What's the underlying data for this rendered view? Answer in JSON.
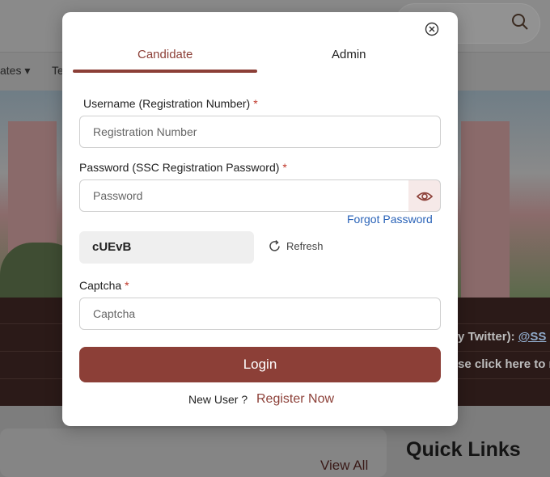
{
  "background": {
    "nav_items": [
      "ates ▾",
      "Te"
    ],
    "band_lines": [
      {
        "text": "rly Twitter):",
        "link": "@SS"
      },
      {
        "text": "se click here to r",
        "link": ""
      }
    ],
    "view_all": "View All",
    "quick_links": "Quick Links"
  },
  "modal": {
    "tabs": {
      "candidate": "Candidate",
      "admin": "Admin"
    },
    "username": {
      "label": "Username (Registration Number)",
      "required": "*",
      "placeholder": "Registration Number"
    },
    "password": {
      "label": "Password (SSC Registration Password)",
      "required": "*",
      "placeholder": "Password"
    },
    "forgot_password": "Forgot Password",
    "captcha_code": "cUEvB",
    "refresh_label": "Refresh",
    "captcha": {
      "label": "Captcha",
      "required": "*",
      "placeholder": "Captcha"
    },
    "login_label": "Login",
    "new_user_text": "New User ?",
    "register_label": "Register Now"
  },
  "colors": {
    "brand": "#8c3f37",
    "link": "#2a63b8",
    "required": "#c0392b"
  },
  "icons": [
    "close-icon",
    "eye-icon",
    "refresh-icon",
    "search-icon"
  ]
}
